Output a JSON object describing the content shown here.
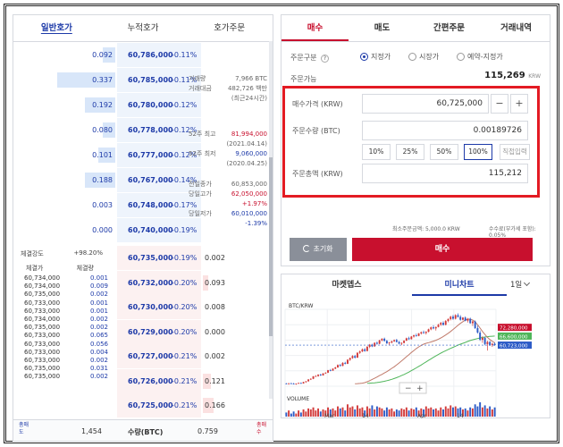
{
  "left_tabs": [
    "일반호가",
    "누적호가",
    "호가주문"
  ],
  "asks": [
    {
      "qty": "0.092",
      "price": "60,786,000",
      "pct": "-0.11%",
      "fill": 0.2
    },
    {
      "qty": "0.337",
      "price": "60,785,000",
      "pct": "-0.11%",
      "fill": 0.95
    },
    {
      "qty": "0.192",
      "price": "60,780,000",
      "pct": "-0.12%",
      "fill": 0.5
    },
    {
      "qty": "0.080",
      "price": "60,778,000",
      "pct": "-0.12%",
      "fill": 0.2
    },
    {
      "qty": "0.101",
      "price": "60,777,000",
      "pct": "-0.12%",
      "fill": 0.28
    },
    {
      "qty": "0.188",
      "price": "60,767,000",
      "pct": "-0.14%",
      "fill": 0.5
    },
    {
      "qty": "0.003",
      "price": "60,748,000",
      "pct": "-0.17%",
      "fill": 0.0
    },
    {
      "qty": "0.000",
      "price": "60,740,000",
      "pct": "-0.19%",
      "fill": 0.0
    }
  ],
  "bids": [
    {
      "price": "60,735,000",
      "pct": "-0.19%",
      "qty": "0.002",
      "fill": 0.0
    },
    {
      "price": "60,732,000",
      "pct": "-0.20%",
      "qty": "0.093",
      "fill": 0.1
    },
    {
      "price": "60,730,000",
      "pct": "-0.20%",
      "qty": "0.008",
      "fill": 0.0
    },
    {
      "price": "60,729,000",
      "pct": "-0.20%",
      "qty": "0.000",
      "fill": 0.0
    },
    {
      "price": "60,727,000",
      "pct": "-0.21%",
      "qty": "0.002",
      "fill": 0.0
    },
    {
      "price": "60,726,000",
      "pct": "-0.21%",
      "qty": "0.121",
      "fill": 0.15
    },
    {
      "price": "60,725,000",
      "pct": "-0.21%",
      "qty": "0.166",
      "fill": 0.2
    }
  ],
  "market_info": {
    "volume_label": "거래량",
    "volume_val": "7,966 BTC",
    "amount_label": "거래대금",
    "amount_val": "482,726 백만",
    "amount_note": "(최근24시간)",
    "high52_label": "52주 최고",
    "high52_val": "81,994,000",
    "high52_date": "(2021.04.14)",
    "low52_label": "52주 최저",
    "low52_val": "9,060,000",
    "low52_date": "(2020.04.25)",
    "prev_close_label": "전일종가",
    "prev_close_val": "60,853,000",
    "today_high_label": "당일고가",
    "today_high_val": "62,050,000",
    "today_high_pct": "+1.97%",
    "today_low_label": "당일저가",
    "today_low_val": "60,010,000",
    "today_low_pct": "-1.39%"
  },
  "strength": {
    "label": "체결강도",
    "value": "+98.20%"
  },
  "trade_headers": {
    "price": "체결가",
    "qty": "체결량"
  },
  "trades": [
    {
      "p": "60,734,000",
      "q": "0.001"
    },
    {
      "p": "60,734,000",
      "q": "0.009"
    },
    {
      "p": "60,735,000",
      "q": "0.002"
    },
    {
      "p": "60,733,000",
      "q": "0.001"
    },
    {
      "p": "60,733,000",
      "q": "0.001"
    },
    {
      "p": "60,734,000",
      "q": "0.002"
    },
    {
      "p": "60,735,000",
      "q": "0.002"
    },
    {
      "p": "60,733,000",
      "q": "0.065"
    },
    {
      "p": "60,733,000",
      "q": "0.056"
    },
    {
      "p": "60,733,000",
      "q": "0.004"
    },
    {
      "p": "60,733,000",
      "q": "0.002"
    },
    {
      "p": "60,735,000",
      "q": "0.031"
    },
    {
      "p": "60,735,000",
      "q": "0.002"
    }
  ],
  "footer": {
    "left_label": "총매도",
    "ask_total": "1,454",
    "qty_label": "수량(BTC)",
    "bid_total": "0.759",
    "right_label": "총매수"
  },
  "right_tabs": [
    "매수",
    "매도",
    "간편주문",
    "거래내역"
  ],
  "order": {
    "type_label": "주문구분",
    "types": [
      "지정가",
      "시장가",
      "예약-지정가"
    ],
    "available_label": "주문가능",
    "available_value": "115,269",
    "available_unit": "KRW",
    "price_label": "매수가격 (KRW)",
    "price_value": "60,725,000",
    "qty_label": "주문수량 (BTC)",
    "qty_value": "0.00189726",
    "pct_buttons": [
      "10%",
      "25%",
      "50%",
      "100%",
      "직접입력"
    ],
    "total_label": "주문총액 (KRW)",
    "total_value": "115,212",
    "min_order": "최소주문금액: 5,000.0 KRW",
    "fee": "수수료(부가세 포함): 0.05%",
    "reset_label": "초기화",
    "buy_label": "매수"
  },
  "chart_tabs": [
    "마켓뎁스",
    "미니차트"
  ],
  "chart_period": "1일",
  "chart_data": {
    "type": "candlestick",
    "title": "BTC/KRW",
    "x_tick_labels": [
      "Mar",
      "14",
      "Apr",
      "14"
    ],
    "price_tags": [
      "72,280,000",
      "66,600,000",
      "60,723,000"
    ],
    "volume_label": "VOLUME",
    "candles": [
      [
        35.8,
        36.0,
        35.2,
        35.5
      ],
      [
        35.5,
        36.0,
        35.0,
        35.9
      ],
      [
        35.9,
        36.2,
        35.4,
        35.6
      ],
      [
        35.6,
        36.1,
        35.2,
        35.4
      ],
      [
        35.4,
        35.8,
        35.0,
        35.7
      ],
      [
        35.7,
        36.3,
        35.5,
        36.1
      ],
      [
        36.1,
        36.4,
        35.6,
        35.8
      ],
      [
        35.8,
        36.9,
        35.7,
        36.7
      ],
      [
        36.7,
        37.4,
        36.2,
        37.2
      ],
      [
        37.2,
        38.6,
        37.0,
        38.4
      ],
      [
        38.4,
        39.2,
        38.0,
        38.8
      ],
      [
        38.8,
        40.6,
        38.6,
        40.4
      ],
      [
        40.4,
        41.2,
        40.0,
        40.6
      ],
      [
        40.6,
        41.8,
        40.2,
        41.5
      ],
      [
        41.5,
        42.1,
        40.7,
        41.0
      ],
      [
        41.0,
        42.6,
        40.9,
        42.3
      ],
      [
        42.3,
        43.1,
        42.0,
        42.8
      ],
      [
        42.8,
        44.6,
        42.6,
        44.4
      ],
      [
        44.4,
        45.2,
        43.7,
        44.1
      ],
      [
        44.1,
        45.6,
        44.0,
        45.4
      ],
      [
        45.4,
        46.6,
        45.1,
        46.2
      ],
      [
        46.2,
        48.2,
        46.0,
        47.8
      ],
      [
        47.8,
        48.4,
        46.8,
        47.2
      ],
      [
        47.2,
        49.6,
        47.0,
        49.2
      ],
      [
        49.2,
        49.9,
        48.2,
        48.6
      ],
      [
        48.6,
        51.6,
        48.4,
        51.2
      ],
      [
        51.2,
        52.6,
        50.4,
        52.3
      ],
      [
        52.3,
        54.2,
        51.8,
        53.6
      ],
      [
        53.6,
        54.4,
        52.0,
        52.6
      ],
      [
        52.6,
        56.2,
        52.3,
        55.7
      ],
      [
        55.7,
        57.2,
        55.0,
        56.6
      ],
      [
        56.6,
        58.6,
        56.2,
        58.0
      ],
      [
        58.0,
        58.8,
        56.4,
        56.9
      ],
      [
        56.9,
        60.2,
        56.6,
        59.6
      ],
      [
        59.6,
        61.4,
        58.8,
        61.0
      ],
      [
        61.0,
        61.6,
        59.4,
        59.9
      ],
      [
        59.9,
        62.6,
        59.6,
        62.2
      ],
      [
        62.2,
        63.1,
        61.0,
        61.6
      ],
      [
        61.6,
        64.2,
        61.3,
        63.8
      ],
      [
        63.8,
        65.2,
        63.2,
        64.9
      ],
      [
        64.9,
        65.6,
        63.0,
        63.5
      ],
      [
        63.5,
        64.1,
        61.4,
        61.9
      ],
      [
        61.9,
        62.8,
        60.6,
        62.4
      ],
      [
        62.4,
        63.6,
        61.8,
        63.2
      ],
      [
        63.2,
        64.4,
        62.8,
        64.0
      ],
      [
        64.0,
        64.8,
        62.4,
        62.8
      ],
      [
        62.8,
        63.4,
        61.2,
        61.7
      ],
      [
        61.7,
        62.6,
        60.7,
        62.1
      ],
      [
        62.1,
        63.9,
        61.9,
        63.6
      ],
      [
        63.6,
        65.6,
        63.4,
        65.2
      ],
      [
        65.2,
        66.2,
        64.1,
        64.6
      ],
      [
        64.6,
        66.6,
        64.4,
        66.3
      ],
      [
        66.3,
        67.6,
        65.6,
        67.1
      ],
      [
        67.1,
        68.2,
        66.2,
        66.7
      ],
      [
        66.7,
        68.6,
        66.5,
        68.3
      ],
      [
        68.3,
        69.6,
        67.6,
        69.1
      ],
      [
        69.1,
        70.2,
        68.1,
        68.6
      ],
      [
        68.6,
        69.8,
        67.6,
        69.4
      ],
      [
        69.4,
        71.4,
        69.0,
        71.0
      ],
      [
        71.0,
        72.8,
        70.4,
        72.3
      ],
      [
        72.3,
        73.6,
        71.0,
        71.6
      ],
      [
        71.6,
        72.8,
        70.2,
        72.5
      ],
      [
        72.5,
        74.6,
        72.2,
        74.0
      ],
      [
        74.0,
        75.8,
        73.2,
        75.2
      ],
      [
        75.2,
        76.2,
        73.4,
        73.9
      ],
      [
        73.9,
        77.0,
        73.6,
        76.4
      ],
      [
        76.4,
        78.2,
        75.6,
        77.6
      ],
      [
        77.6,
        79.8,
        76.8,
        79.2
      ],
      [
        79.2,
        80.4,
        77.2,
        77.9
      ],
      [
        77.9,
        80.8,
        77.4,
        80.2
      ],
      [
        80.2,
        81.4,
        78.6,
        79.1
      ],
      [
        79.1,
        80.2,
        76.6,
        77.2
      ],
      [
        77.2,
        79.0,
        76.8,
        78.6
      ],
      [
        78.6,
        79.4,
        76.2,
        76.6
      ],
      [
        76.6,
        78.4,
        75.4,
        77.8
      ],
      [
        77.8,
        78.6,
        74.6,
        75.0
      ],
      [
        75.0,
        76.6,
        73.2,
        76.1
      ],
      [
        76.1,
        76.8,
        71.2,
        71.8
      ],
      [
        71.8,
        73.4,
        68.2,
        68.9
      ],
      [
        68.9,
        70.2,
        63.4,
        64.2
      ],
      [
        64.2,
        66.6,
        62.2,
        65.4
      ],
      [
        65.4,
        66.2,
        60.6,
        61.4
      ],
      [
        61.4,
        63.6,
        57.2,
        62.8
      ],
      [
        62.8,
        63.4,
        60.2,
        60.8
      ],
      [
        60.8,
        62.2,
        59.6,
        61.6
      ],
      [
        61.6,
        62.4,
        60.2,
        60.7
      ]
    ],
    "ma_short": [
      35.6,
      35.7,
      35.8,
      36.0,
      36.3,
      36.9,
      37.6,
      38.4,
      39.2,
      40.0,
      40.9,
      41.7,
      42.6,
      43.5,
      44.5,
      45.6,
      46.6,
      47.9,
      49.1,
      50.4,
      51.8,
      53.2,
      54.5,
      55.9,
      57.2,
      58.5,
      59.6,
      60.5,
      61.3,
      61.9,
      62.3,
      62.8,
      63.3,
      63.9,
      64.6,
      65.4,
      66.3,
      67.3,
      68.4,
      69.6,
      70.9,
      72.2,
      73.6,
      74.9,
      76.0,
      77.0,
      77.6,
      77.6,
      77.0,
      75.8,
      74.0,
      71.8,
      69.6,
      67.6,
      65.8,
      64.4,
      63.2,
      62.3
    ],
    "ma_long": [
      35.9,
      36.0,
      36.1,
      36.2,
      36.4,
      36.6,
      36.9,
      37.2,
      37.6,
      38.0,
      38.5,
      39.0,
      39.6,
      40.2,
      40.9,
      41.6,
      42.4,
      43.2,
      44.1,
      45.0,
      45.9,
      46.9,
      47.8,
      48.8,
      49.8,
      50.8,
      51.8,
      52.8,
      53.7,
      54.6,
      55.5,
      56.3,
      57.1,
      57.9,
      58.6,
      59.3,
      60.0,
      60.7,
      61.3,
      61.9,
      62.5,
      63.1,
      63.7,
      64.2,
      64.6,
      65.0,
      65.4,
      65.7,
      66.0,
      66.2,
      66.4,
      66.5,
      66.6
    ],
    "volume": [
      4,
      6,
      3,
      5,
      3,
      6,
      4,
      7,
      5,
      8,
      7,
      9,
      6,
      8,
      5,
      7,
      6,
      9,
      7,
      8,
      6,
      10,
      8,
      9,
      6,
      12,
      9,
      10,
      7,
      11,
      8,
      9,
      6,
      10,
      8,
      11,
      7,
      10,
      9,
      8,
      6,
      9,
      7,
      8,
      5,
      7,
      6,
      8,
      7,
      9,
      6,
      8,
      7,
      9,
      6,
      8,
      7,
      10,
      8,
      9,
      7,
      8,
      6,
      9,
      7,
      10,
      8,
      11,
      9,
      10,
      8,
      9,
      7,
      8,
      6,
      9,
      8,
      12,
      10,
      14,
      9,
      11,
      8,
      10,
      7,
      9
    ],
    "y_range": [
      34,
      84
    ]
  }
}
